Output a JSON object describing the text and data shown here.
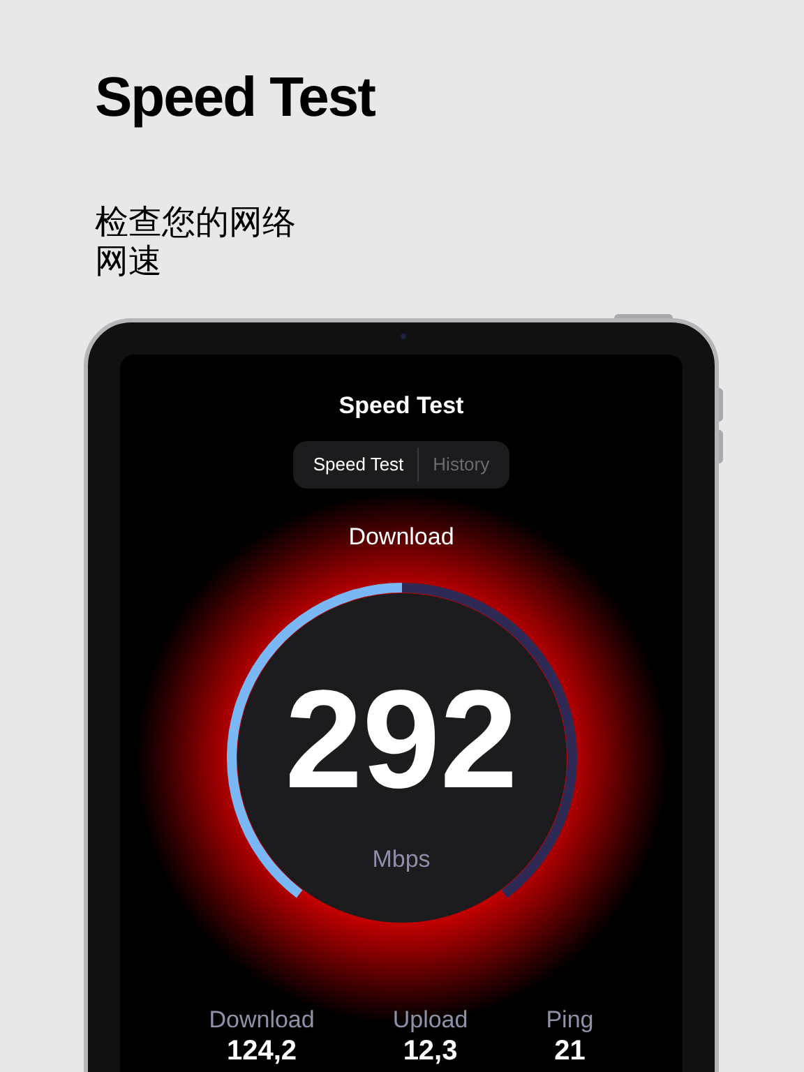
{
  "header": {
    "title": "Speed Test",
    "subtitle": "检查您的网络网速"
  },
  "app": {
    "title": "Speed Test",
    "tabs": [
      {
        "label": "Speed Test",
        "selected": true
      },
      {
        "label": "History",
        "selected": false
      }
    ],
    "gauge": {
      "label": "Download",
      "value": "292",
      "unit": "Mbps"
    },
    "stats": [
      {
        "label": "Download",
        "value": "124,2"
      },
      {
        "label": "Upload",
        "value": "12,3"
      },
      {
        "label": "Ping",
        "value": "21"
      }
    ]
  }
}
